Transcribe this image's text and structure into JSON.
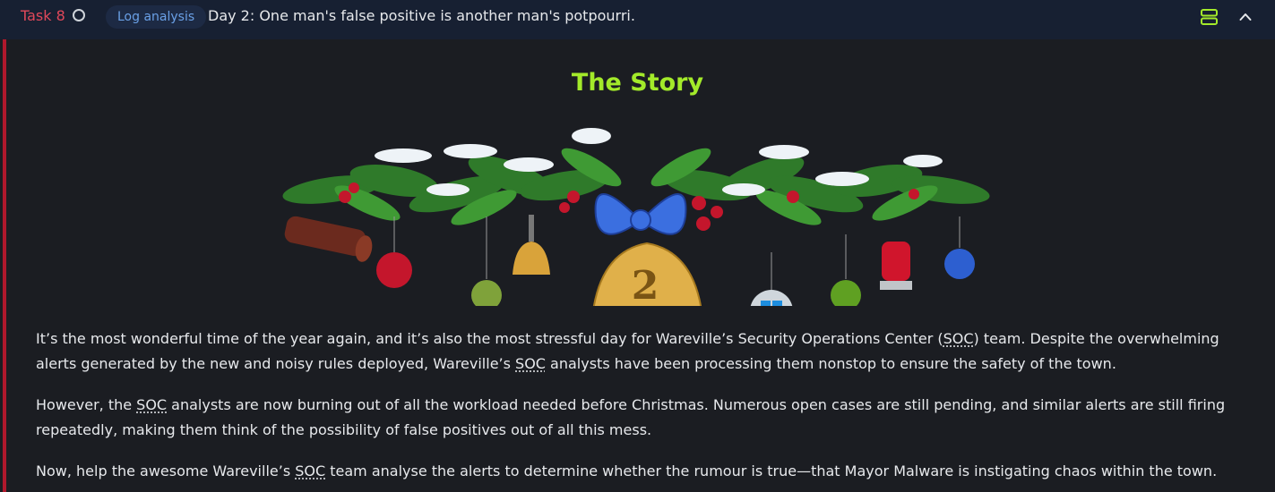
{
  "header": {
    "task_label": "Task 8",
    "tag": "Log analysis",
    "title": "Day 2: One man's false positive is another man's potpourri."
  },
  "story": {
    "title": "The Story",
    "day_number": "2",
    "paragraphs": [
      {
        "segments": [
          "It’s the most wonderful time of the year again, and it’s also the most stressful day for Wareville’s Security Operations Center (",
          "SOC",
          ") team. Despite the overwhelming alerts generated by the new and noisy rules deployed, Wareville’s ",
          "SOC",
          " analysts have been processing them nonstop to ensure the safety of the town."
        ]
      },
      {
        "segments": [
          "However, the ",
          "SOC",
          " analysts are now burning out of all the workload needed before Christmas. Numerous open cases are still pending, and similar alerts are still firing repeatedly, making them think of the possibility of false positives out of all this mess."
        ]
      },
      {
        "segments": [
          "Now, help the awesome Wareville’s ",
          "SOC",
          " team analyse the alerts to determine whether the rumour is true—that Mayor Malware is instigating chaos within the town."
        ]
      }
    ]
  },
  "colors": {
    "task_accent": "#e0485a",
    "title_green": "#a3ea2a",
    "tag_text": "#6aa0e6",
    "accent_bar": "#b0182c"
  },
  "icons": [
    "status-circle-icon",
    "server-icon",
    "chevron-up-icon"
  ]
}
